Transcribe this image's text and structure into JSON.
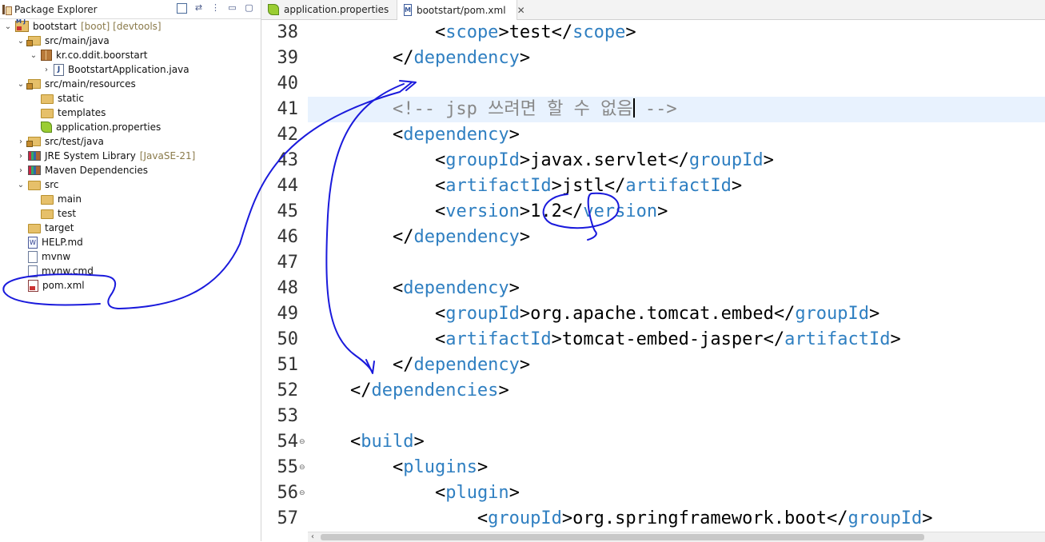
{
  "explorer": {
    "title": "Package Explorer",
    "tree": [
      {
        "label": "bootstart",
        "decoration": "[boot] [devtools]",
        "icon": "project-icon",
        "chevron": "v"
      },
      {
        "label": "src/main/java",
        "decoration": "",
        "icon": "source-folder-icon",
        "chevron": "v"
      },
      {
        "label": "kr.co.ddit.boorstart",
        "decoration": "",
        "icon": "package-icon",
        "chevron": "v"
      },
      {
        "label": "BootstartApplication.java",
        "decoration": "",
        "icon": "java-file-icon",
        "chevron": ">"
      },
      {
        "label": "src/main/resources",
        "decoration": "",
        "icon": "source-folder-icon",
        "chevron": "v"
      },
      {
        "label": "static",
        "decoration": "",
        "icon": "folder-icon",
        "chevron": ""
      },
      {
        "label": "templates",
        "decoration": "",
        "icon": "folder-icon",
        "chevron": ""
      },
      {
        "label": "application.properties",
        "decoration": "",
        "icon": "properties-file-icon",
        "chevron": ""
      },
      {
        "label": "src/test/java",
        "decoration": "",
        "icon": "source-folder-icon",
        "chevron": ">"
      },
      {
        "label": "JRE System Library",
        "decoration": "[JavaSE-21]",
        "icon": "library-icon",
        "chevron": ">"
      },
      {
        "label": "Maven Dependencies",
        "decoration": "",
        "icon": "library-icon",
        "chevron": ">"
      },
      {
        "label": "src",
        "decoration": "",
        "icon": "folder-icon",
        "chevron": "v"
      },
      {
        "label": "main",
        "decoration": "",
        "icon": "folder-icon",
        "chevron": ""
      },
      {
        "label": "test",
        "decoration": "",
        "icon": "folder-icon",
        "chevron": ""
      },
      {
        "label": "target",
        "decoration": "",
        "icon": "folder-icon",
        "chevron": ""
      },
      {
        "label": "HELP.md",
        "decoration": "",
        "icon": "markdown-file-icon",
        "chevron": ""
      },
      {
        "label": "mvnw",
        "decoration": "",
        "icon": "file-icon",
        "chevron": ""
      },
      {
        "label": "mvnw.cmd",
        "decoration": "",
        "icon": "file-icon",
        "chevron": ""
      },
      {
        "label": "pom.xml",
        "decoration": "",
        "icon": "xml-file-icon",
        "chevron": ""
      }
    ]
  },
  "editor": {
    "tabs": [
      {
        "label": "application.properties",
        "active": false
      },
      {
        "label": "bootstart/pom.xml",
        "active": true
      }
    ],
    "lines": [
      {
        "num": "38",
        "fold": "",
        "text": "            <scope>test</scope>"
      },
      {
        "num": "39",
        "fold": "",
        "text": "        </dependency>"
      },
      {
        "num": "40",
        "fold": "",
        "text": ""
      },
      {
        "num": "41",
        "fold": "",
        "text": "        <!-- jsp 쓰려면 할 수 없음 -->"
      },
      {
        "num": "42",
        "fold": "",
        "text": "        <dependency>"
      },
      {
        "num": "43",
        "fold": "",
        "text": "            <groupId>javax.servlet</groupId>"
      },
      {
        "num": "44",
        "fold": "",
        "text": "            <artifactId>jstl</artifactId>"
      },
      {
        "num": "45",
        "fold": "",
        "text": "            <version>1.2</version>"
      },
      {
        "num": "46",
        "fold": "",
        "text": "        </dependency>"
      },
      {
        "num": "47",
        "fold": "",
        "text": ""
      },
      {
        "num": "48",
        "fold": "",
        "text": "        <dependency>"
      },
      {
        "num": "49",
        "fold": "",
        "text": "            <groupId>org.apache.tomcat.embed</groupId>"
      },
      {
        "num": "50",
        "fold": "",
        "text": "            <artifactId>tomcat-embed-jasper</artifactId>"
      },
      {
        "num": "51",
        "fold": "",
        "text": "        </dependency>"
      },
      {
        "num": "52",
        "fold": "",
        "text": "    </dependencies>"
      },
      {
        "num": "53",
        "fold": "",
        "text": ""
      },
      {
        "num": "54",
        "fold": "⊖",
        "text": "    <build>"
      },
      {
        "num": "55",
        "fold": "⊖",
        "text": "        <plugins>"
      },
      {
        "num": "56",
        "fold": "⊖",
        "text": "            <plugin>"
      },
      {
        "num": "57",
        "fold": "",
        "text": "                <groupId>org.springframework.boot</groupId>"
      }
    ],
    "highlighted_line": "41"
  },
  "colors": {
    "tag": "#2f7fc1",
    "comment": "#888888",
    "current_line": "#e8f2fe",
    "annotation_ink": "#1a1adc"
  }
}
